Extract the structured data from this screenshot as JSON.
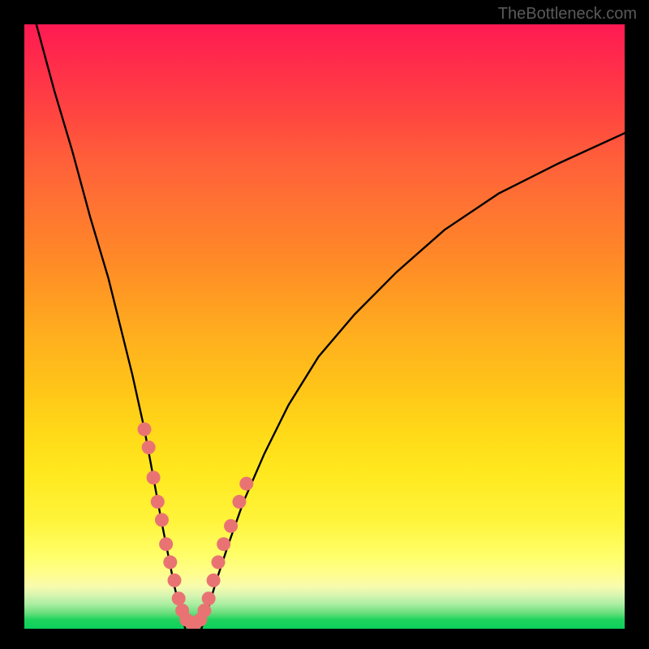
{
  "watermark": "TheBottleneck.com",
  "chart_data": {
    "type": "line",
    "title": "",
    "xlabel": "",
    "ylabel": "",
    "xlim": [
      0,
      100
    ],
    "ylim": [
      0,
      100
    ],
    "series": [
      {
        "name": "left-curve",
        "x": [
          2,
          5,
          8,
          11,
          14,
          16,
          18,
          20,
          21.5,
          22.8,
          24,
          25,
          26,
          26.8
        ],
        "y": [
          100,
          89,
          79,
          68,
          58,
          50,
          42,
          33,
          25,
          18,
          12,
          7,
          3,
          0
        ]
      },
      {
        "name": "right-curve",
        "x": [
          29.5,
          30.5,
          32,
          34,
          36.5,
          40,
          44,
          49,
          55,
          62,
          70,
          79,
          89,
          100
        ],
        "y": [
          0,
          3,
          8,
          14,
          21,
          29,
          37,
          45,
          52,
          59,
          66,
          72,
          77,
          82
        ]
      }
    ],
    "scatter_points": {
      "left_cluster": [
        {
          "x": 20.0,
          "y": 33
        },
        {
          "x": 20.7,
          "y": 30
        },
        {
          "x": 21.5,
          "y": 25
        },
        {
          "x": 22.2,
          "y": 21
        },
        {
          "x": 22.9,
          "y": 18
        },
        {
          "x": 23.6,
          "y": 14
        },
        {
          "x": 24.3,
          "y": 11
        },
        {
          "x": 25.0,
          "y": 8
        },
        {
          "x": 25.7,
          "y": 5
        },
        {
          "x": 26.3,
          "y": 3
        }
      ],
      "bottom_cluster": [
        {
          "x": 27.0,
          "y": 1.5
        },
        {
          "x": 27.8,
          "y": 1.0
        },
        {
          "x": 28.5,
          "y": 1.0
        },
        {
          "x": 29.3,
          "y": 1.5
        }
      ],
      "right_cluster": [
        {
          "x": 30.0,
          "y": 3
        },
        {
          "x": 30.7,
          "y": 5
        },
        {
          "x": 31.5,
          "y": 8
        },
        {
          "x": 32.3,
          "y": 11
        },
        {
          "x": 33.2,
          "y": 14
        },
        {
          "x": 34.4,
          "y": 17
        },
        {
          "x": 35.8,
          "y": 21
        },
        {
          "x": 37.0,
          "y": 24
        }
      ]
    },
    "colors": {
      "curve": "#000000",
      "dots": "#e97373",
      "gradient_top": "#ff1a52",
      "gradient_mid": "#ffc418",
      "gradient_bottom": "#0bd05c"
    }
  }
}
